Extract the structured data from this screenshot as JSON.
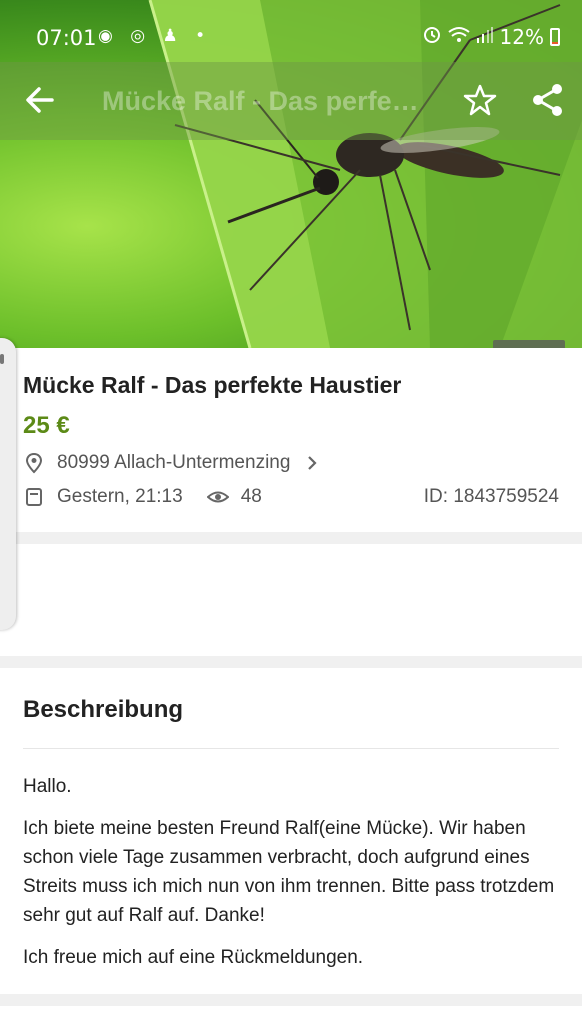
{
  "status_bar": {
    "time": "07:01",
    "notification_icons": "◉ ◎ ♟ •",
    "battery": "12%",
    "battery_level": 0.12
  },
  "toolbar": {
    "title": "Mücke Ralf - Das perfekt..."
  },
  "listing": {
    "title": "Mücke Ralf - Das perfekte Haustier",
    "price": "25 €",
    "location": "80999 Allach-Untermenzing",
    "date": "Gestern, 21:13",
    "views": "48",
    "id": "ID: 1843759524"
  },
  "description": {
    "heading": "Beschreibung",
    "paragraphs": [
      "Hallo.",
      "Ich biete meine besten Freund Ralf(eine Mücke). Wir haben schon viele Tage zusammen verbracht, doch aufgrund eines Streits muss ich mich nun von ihm trennen. Bitte pass trotzdem sehr gut auf Ralf auf. Danke!",
      "Ich freue mich auf eine Rückmeldungen."
    ]
  },
  "colors": {
    "price": "#5c8a17",
    "battery_low": "#e85a2a"
  },
  "icons": [
    "back-arrow-icon",
    "star-icon",
    "share-icon",
    "location-pin-icon",
    "chevron-right-icon",
    "calendar-icon",
    "eye-icon",
    "alarm-icon",
    "wifi-icon",
    "signal-icon",
    "battery-icon"
  ]
}
